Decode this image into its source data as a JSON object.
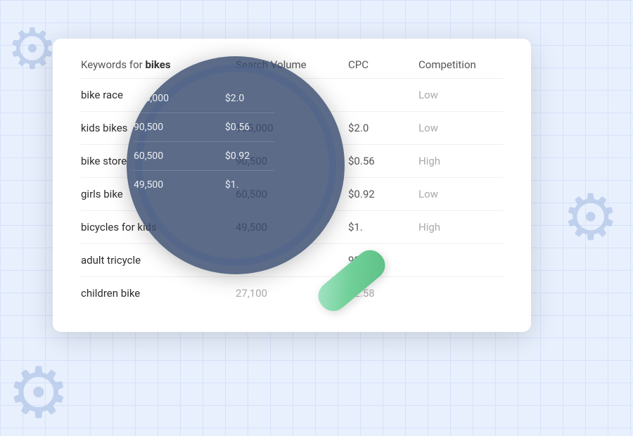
{
  "background": {
    "color": "#dce8f8"
  },
  "card": {
    "header": {
      "keywords_label": "Keywords for ",
      "keywords_bold": "bikes",
      "col_volume": "Search Volume",
      "col_cpc": "CPC",
      "col_competition": "Competition"
    },
    "rows": [
      {
        "keyword": "bike race",
        "volume": "",
        "cpc": "",
        "competition": "Low",
        "volume_faded": true,
        "cpc_faded": true
      },
      {
        "keyword": "kids bikes",
        "volume": "135,000",
        "cpc": "$2.0",
        "competition": "Low",
        "volume_faded": false,
        "cpc_faded": false
      },
      {
        "keyword": "bike store",
        "volume": "90,500",
        "cpc": "$0.56",
        "competition": "High",
        "volume_faded": false,
        "cpc_faded": false
      },
      {
        "keyword": "girls bike",
        "volume": "60,500",
        "cpc": "$0.92",
        "competition": "Low",
        "volume_faded": false,
        "cpc_faded": false
      },
      {
        "keyword": "bicycles for kids",
        "volume": "49,500",
        "cpc": "$1.",
        "competition": "High",
        "volume_faded": false,
        "cpc_faded": false
      },
      {
        "keyword": "adult tricycle",
        "volume": "",
        "cpc": "90",
        "competition": "",
        "volume_faded": true,
        "cpc_faded": false
      },
      {
        "keyword": "children bike",
        "volume": "27,100",
        "cpc": "$2.58",
        "competition": "",
        "volume_faded": false,
        "cpc_faded": false
      }
    ]
  },
  "magnifier": {
    "lens_rows": [
      {
        "volume": "135,000",
        "cpc": "$2.0"
      },
      {
        "volume": "90,500",
        "cpc": "$0.56"
      },
      {
        "volume": "60,500",
        "cpc": "$0.92"
      },
      {
        "volume": "49,500",
        "cpc": "$1."
      }
    ]
  },
  "gears": {
    "symbol": "⚙"
  }
}
